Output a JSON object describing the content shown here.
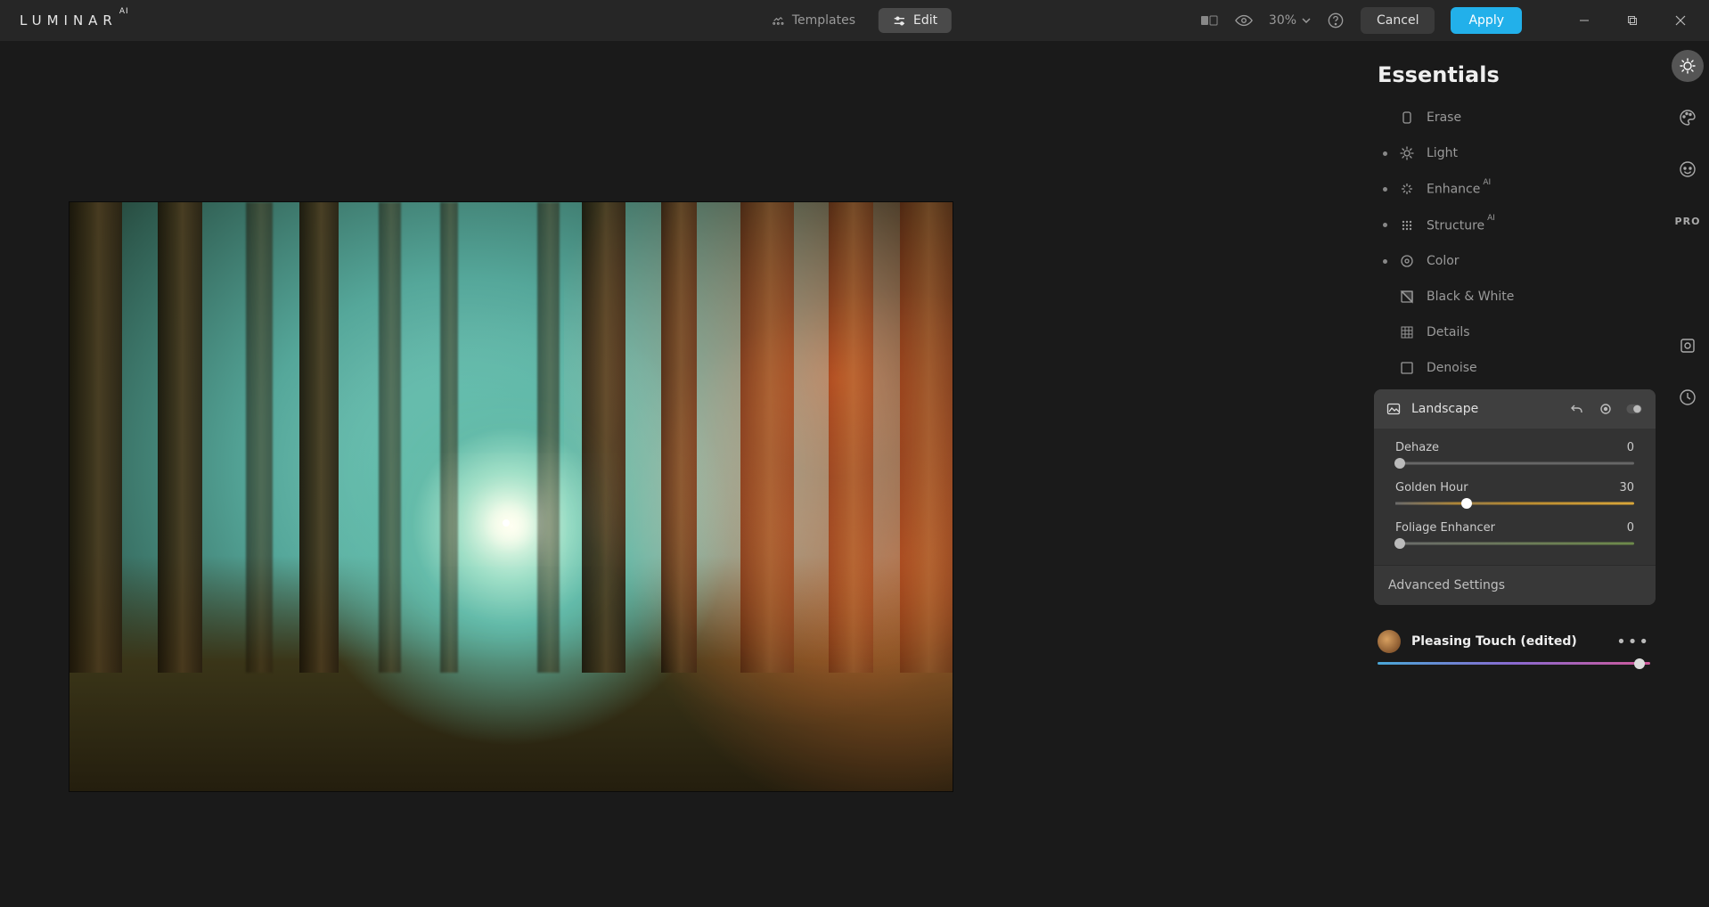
{
  "app": {
    "name": "LUMINAR",
    "suffix": "AI"
  },
  "topbar": {
    "templates_label": "Templates",
    "edit_label": "Edit",
    "zoom": "30%",
    "cancel": "Cancel",
    "apply": "Apply"
  },
  "right": {
    "title": "Essentials",
    "tools": [
      {
        "label": "Erase",
        "has_dot": false
      },
      {
        "label": "Light",
        "has_dot": true
      },
      {
        "label": "Enhance",
        "has_dot": true,
        "ai": true
      },
      {
        "label": "Structure",
        "has_dot": true,
        "ai": true
      },
      {
        "label": "Color",
        "has_dot": true
      },
      {
        "label": "Black & White",
        "has_dot": false
      },
      {
        "label": "Details",
        "has_dot": false
      },
      {
        "label": "Denoise",
        "has_dot": false
      }
    ],
    "expanded": {
      "label": "Landscape",
      "sliders": {
        "dehaze": {
          "label": "Dehaze",
          "value": 0
        },
        "golden": {
          "label": "Golden Hour",
          "value": 30
        },
        "foliage": {
          "label": "Foliage Enhancer",
          "value": 0
        }
      },
      "advanced": "Advanced Settings"
    },
    "applied": {
      "name": "Pleasing Touch (edited)",
      "amount_pct": 96
    }
  },
  "toolstrip_pro": "PRO"
}
